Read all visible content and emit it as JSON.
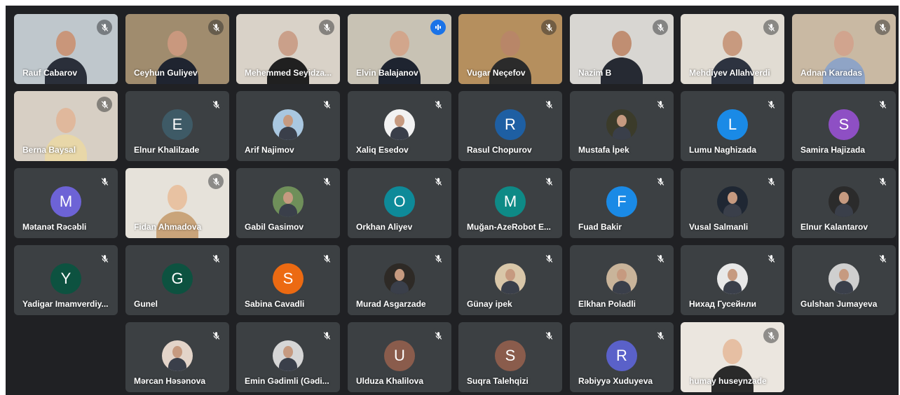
{
  "participants": [
    {
      "name": "Rauf Cabarov",
      "kind": "video",
      "bg": "#bfc7cc",
      "skin": "#c9967a",
      "shirt": "#2a2f3a",
      "mic": "muted"
    },
    {
      "name": "Ceyhun Guliyev",
      "kind": "video",
      "bg": "#a08c6e",
      "skin": "#c9987e",
      "shirt": "#1f2430",
      "mic": "muted"
    },
    {
      "name": "Mehemmed Seyidza...",
      "kind": "video",
      "bg": "#d9d2c8",
      "skin": "#caa08a",
      "shirt": "#202020",
      "mic": "muted"
    },
    {
      "name": "Elvin Balajanov",
      "kind": "video",
      "bg": "#c8c2b4",
      "skin": "#d2a68c",
      "shirt": "#1e2430",
      "mic": "active",
      "speaking": true
    },
    {
      "name": "Vugar Neçefov",
      "kind": "video",
      "bg": "#b58f5e",
      "skin": "#b88668",
      "shirt": "#2b2b2b",
      "mic": "muted"
    },
    {
      "name": "Nazim B",
      "kind": "video",
      "bg": "#d8d6d2",
      "skin": "#c08e72",
      "shirt": "#262a33",
      "mic": "muted"
    },
    {
      "name": "Mehdiyev Allahverdi",
      "kind": "video",
      "bg": "#e1dcd3",
      "skin": "#c89a7f",
      "shirt": "#2d3340",
      "mic": "muted"
    },
    {
      "name": "Adnan Karadas",
      "kind": "video",
      "bg": "#c9b9a3",
      "skin": "#d1a48e",
      "shirt": "#8fa4c6",
      "mic": "muted"
    },
    {
      "name": "Berna Baysal",
      "kind": "video",
      "bg": "#d7cfc4",
      "skin": "#e0b89c",
      "shirt": "#e8d7a8",
      "mic": "muted"
    },
    {
      "name": "Elnur Khalilzade",
      "kind": "avatar",
      "letter": "E",
      "color": "#3e5a66",
      "mic": "muted"
    },
    {
      "name": "Arif Najimov",
      "kind": "photo",
      "color": "#a9c7e0",
      "mic": "muted"
    },
    {
      "name": "Xaliq Esedov",
      "kind": "photo",
      "color": "#f2f2f2",
      "mic": "muted"
    },
    {
      "name": "Rasul Chopurov",
      "kind": "avatar",
      "letter": "R",
      "color": "#1e5fa3",
      "mic": "muted"
    },
    {
      "name": "Mustafa İpek",
      "kind": "photo",
      "color": "#3b3b2a",
      "mic": "muted"
    },
    {
      "name": "Lumu Naghizada",
      "kind": "avatar",
      "letter": "L",
      "color": "#1a8ae6",
      "mic": "muted"
    },
    {
      "name": "Samira Hajizada",
      "kind": "avatar",
      "letter": "S",
      "color": "#8e4fc4",
      "mic": "muted"
    },
    {
      "name": "Mətanət Rəcəbli",
      "kind": "avatar",
      "letter": "M",
      "color": "#6d63d6",
      "mic": "muted"
    },
    {
      "name": "Fidan Ahmadova",
      "kind": "video",
      "bg": "#e6e2da",
      "skin": "#e8c2a2",
      "shirt": "#c9a47a",
      "mic": "muted"
    },
    {
      "name": "Gabil Gasimov",
      "kind": "photo",
      "color": "#6f8f5a",
      "mic": "muted"
    },
    {
      "name": "Orkhan Aliyev",
      "kind": "avatar",
      "letter": "O",
      "color": "#0e8a99",
      "mic": "muted"
    },
    {
      "name": "Muğan-AzeRobot E...",
      "kind": "avatar",
      "letter": "M",
      "color": "#0e8a86",
      "mic": "muted"
    },
    {
      "name": "Fuad Bakir",
      "kind": "avatar",
      "letter": "F",
      "color": "#1a8ae6",
      "mic": "muted"
    },
    {
      "name": "Vusal Salmanli",
      "kind": "photo",
      "color": "#1f2733",
      "mic": "muted"
    },
    {
      "name": "Elnur Kalantarov",
      "kind": "photo",
      "color": "#2b2b2b",
      "mic": "muted"
    },
    {
      "name": "Yadigar Imamverdiy...",
      "kind": "avatar",
      "letter": "Y",
      "color": "#0d5240",
      "mic": "muted"
    },
    {
      "name": "Gunel",
      "kind": "avatar",
      "letter": "G",
      "color": "#0d5240",
      "mic": "muted"
    },
    {
      "name": "Sabina Cavadli",
      "kind": "avatar",
      "letter": "S",
      "color": "#ec6a12",
      "mic": "muted"
    },
    {
      "name": "Murad Asgarzade",
      "kind": "photo",
      "color": "#2e2a26",
      "mic": "muted"
    },
    {
      "name": "Günay ipek",
      "kind": "photo",
      "color": "#d9c7a9",
      "mic": "muted"
    },
    {
      "name": "Elkhan Poladli",
      "kind": "photo",
      "color": "#c9b49a",
      "mic": "muted"
    },
    {
      "name": "Нихад Гусейнли",
      "kind": "photo",
      "color": "#e8e8e8",
      "mic": "muted"
    },
    {
      "name": "Gulshan Jumayeva",
      "kind": "photo",
      "color": "#cfcfcf",
      "mic": "muted"
    },
    {
      "name": "Mərcan Həsənova",
      "kind": "photo",
      "color": "#e3d4c9",
      "mic": "muted"
    },
    {
      "name": "Emin Gədimli (Gədi...",
      "kind": "photo",
      "color": "#d6d6d6",
      "mic": "muted"
    },
    {
      "name": "Ulduza Khalilova",
      "kind": "avatar",
      "letter": "U",
      "color": "#8a5c4c",
      "mic": "muted"
    },
    {
      "name": "Suqra Talehqizi",
      "kind": "avatar",
      "letter": "S",
      "color": "#8a5c4c",
      "mic": "muted"
    },
    {
      "name": "Rəbiyyə Xuduyeva",
      "kind": "avatar",
      "letter": "R",
      "color": "#5a61c9",
      "mic": "muted"
    },
    {
      "name": "humay huseynzade",
      "kind": "video",
      "bg": "#ebe6df",
      "skin": "#e6bfa3",
      "shirt": "#2a2a2a",
      "mic": "muted"
    }
  ]
}
